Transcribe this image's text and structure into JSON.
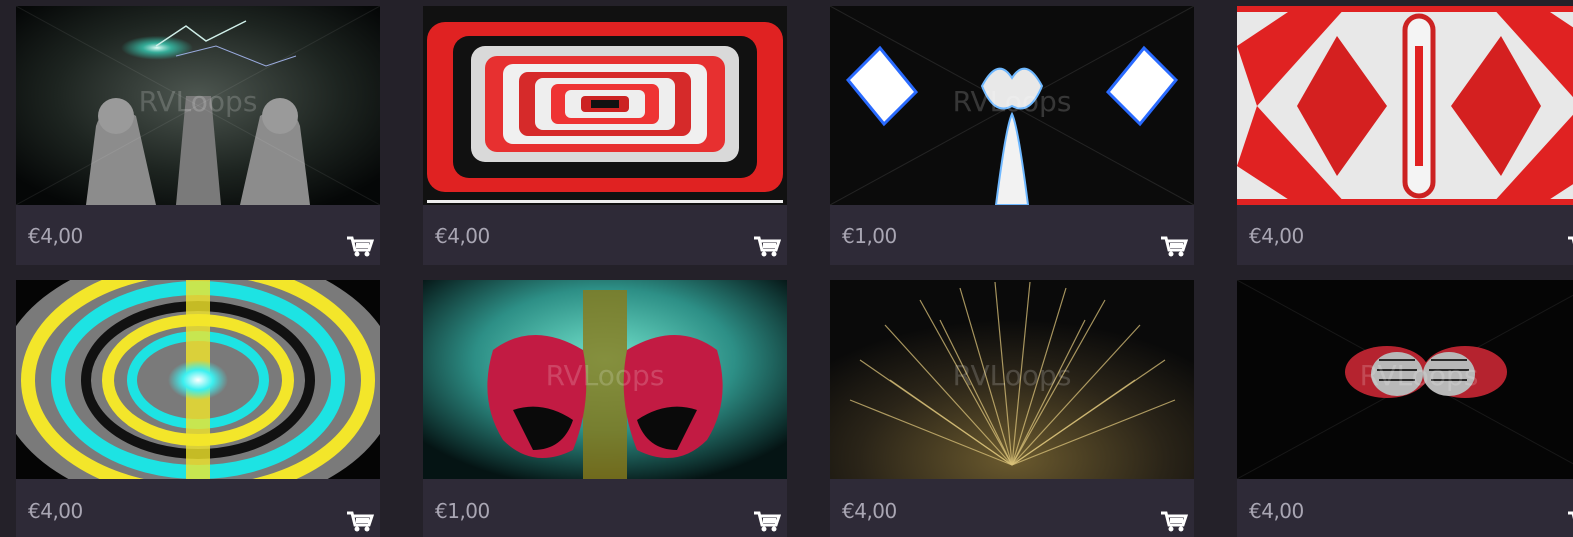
{
  "products": [
    {
      "price": "€4,00",
      "cart_icon": "shopping-cart-icon"
    },
    {
      "price": "€4,00",
      "cart_icon": "shopping-cart-icon"
    },
    {
      "price": "€1,00",
      "cart_icon": "shopping-cart-icon"
    },
    {
      "price": "€4,00",
      "cart_icon": "shopping-cart-icon"
    },
    {
      "price": "€4,00",
      "cart_icon": "shopping-cart-icon"
    },
    {
      "price": "€1,00",
      "cart_icon": "shopping-cart-icon"
    },
    {
      "price": "€4,00",
      "cart_icon": "shopping-cart-icon"
    },
    {
      "price": "€4,00",
      "cart_icon": "shopping-cart-icon"
    }
  ],
  "watermark": "RVLoops",
  "colors": {
    "background": "#242129",
    "card": "#2e2a37",
    "price_text": "#a9a6b3"
  }
}
